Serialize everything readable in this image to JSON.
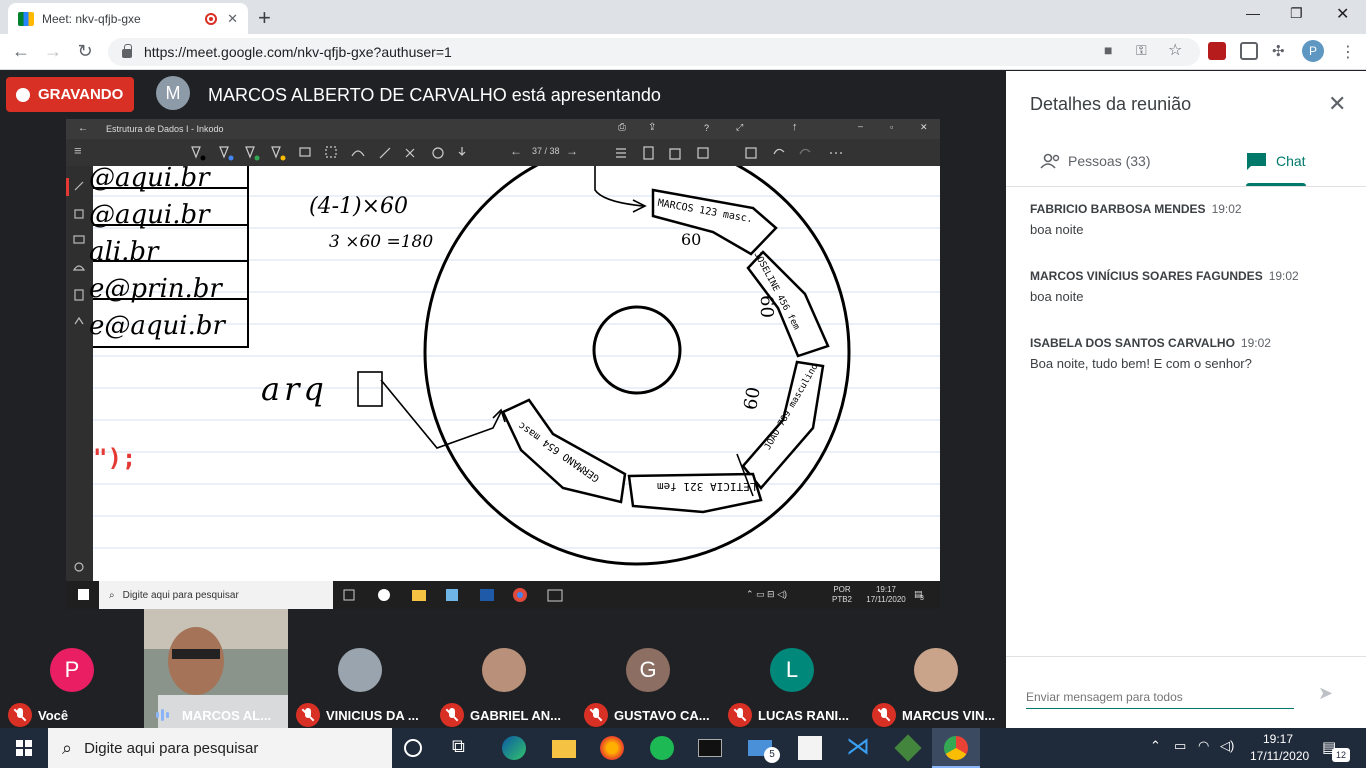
{
  "browser": {
    "tab_title": "Meet: nkv-qfjb-gxe",
    "url": "https://meet.google.com/nkv-qfjb-gxe?authuser=1",
    "profile_initial": "P"
  },
  "meet": {
    "recording_label": "GRAVANDO",
    "presenter_initial": "M",
    "presenter_text": "MARCOS ALBERTO DE CARVALHO está apresentando"
  },
  "shared_screen": {
    "app_title": "Estrutura de Dados I - Inkodo",
    "page_indicator": "37 / 38",
    "taskbar_search": "Digite aqui para pesquisar",
    "tray_lang": "POR",
    "tray_layout": "PTB2",
    "tray_time": "19:17",
    "tray_date": "17/11/2020",
    "notif_count": "3",
    "handwriting": {
      "emails": [
        "@aqui.br",
        "@aqui.br",
        "ali.br",
        "e@prin.br",
        "e@aqui.br"
      ],
      "calc1": "(4-1)×60",
      "calc2": "3 ×60 =180",
      "var": "arq",
      "code": "\");",
      "rec1": "MARCOS 123 masc.",
      "rec1_num": "60",
      "rec2": "JOSELINE 456 fem",
      "rec2_num": "60",
      "rec3": "JOAO 789 masculino",
      "rec3_num": "60",
      "rec4": "LETICIA 321 fem",
      "rec5": "GERMANO 654 masc"
    }
  },
  "participants": [
    {
      "name": "Você",
      "initial": "P",
      "color": "#e91e63",
      "muted": true
    },
    {
      "name": "MARCOS AL...",
      "initial": "",
      "color": "#6b7a6a",
      "muted": false
    },
    {
      "name": "VINICIUS DA ...",
      "initial": "",
      "color": "#9aa4ae",
      "muted": true
    },
    {
      "name": "GABRIEL AN...",
      "initial": "",
      "color": "#b99079",
      "muted": true
    },
    {
      "name": "GUSTAVO CA...",
      "initial": "G",
      "color": "#8d6e63",
      "muted": true
    },
    {
      "name": "LUCAS RANI...",
      "initial": "L",
      "color": "#00897b",
      "muted": true
    },
    {
      "name": "MARCUS VIN...",
      "initial": "",
      "color": "#c9a48a",
      "muted": true
    }
  ],
  "panel": {
    "title": "Detalhes da reunião",
    "tab_people": "Pessoas (33)",
    "tab_chat": "Chat",
    "messages": [
      {
        "sender": "FABRICIO BARBOSA MENDES",
        "time": "19:02",
        "text": "boa noite"
      },
      {
        "sender": "MARCOS VINÍCIUS SOARES FAGUNDES",
        "time": "19:02",
        "text": "boa noite"
      },
      {
        "sender": "ISABELA DOS SANTOS CARVALHO",
        "time": "19:02",
        "text": "Boa noite, tudo bem! E com o senhor?"
      }
    ],
    "input_placeholder": "Enviar mensagem para todos"
  },
  "taskbar": {
    "search_placeholder": "Digite aqui para pesquisar",
    "mail_badge": "5",
    "time": "19:17",
    "date": "17/11/2020",
    "notif_count": "12"
  },
  "colors": {
    "recording": "#d93025",
    "chat_accent": "#00796b",
    "meet_bg": "#202124"
  }
}
